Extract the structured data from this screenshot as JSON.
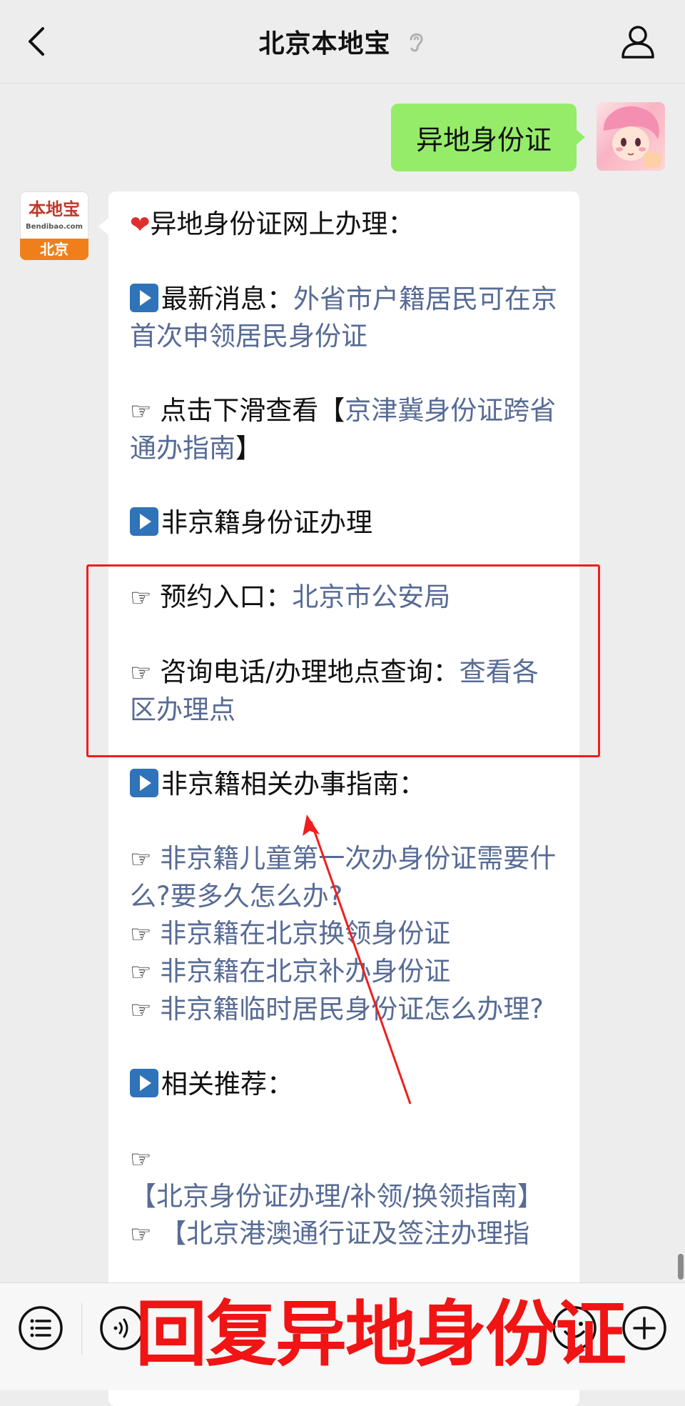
{
  "header": {
    "title": "北京本地宝"
  },
  "chat": {
    "outgoing_text": "异地身份证",
    "bot_avatar": {
      "logo_top": "本地宝",
      "logo_url": "Bendibao.com",
      "logo_bottom": "北京"
    },
    "message": {
      "heading": "异地身份证网上办理：",
      "news_label": "最新消息：",
      "news_link": "外省市户籍居民可在京首次申领居民身份证",
      "slide_prefix": "点击下滑查看【",
      "slide_link": "京津冀身份证跨省通办指南",
      "slide_suffix": "】",
      "section_nonlocal": "非京籍身份证办理",
      "appointment_label": "预约入口：",
      "appointment_link": "北京市公安局",
      "consult_label": "咨询电话/办理地点查询：",
      "consult_link": "查看各区办理点",
      "section_guide": "非京籍相关办事指南：",
      "guide_links": [
        "非京籍儿童第一次办身份证需要什么?要多久怎么办?",
        "非京籍在北京换领身份证",
        "非京籍在北京补办身份证",
        "非京籍临时居民身份证怎么办理?"
      ],
      "section_related": "相关推荐：",
      "related_link_1": "【北京身份证办理/补领/换领指南】",
      "related_link_2": "【北京港澳通行证及签注办理指"
    }
  },
  "overlay": {
    "caption": "回复异地身份证",
    "annotation_color": "#f01e1e"
  },
  "colors": {
    "background": "#ededed",
    "outgoing_bubble": "#95ec69",
    "incoming_bubble": "#ffffff",
    "link": "#576b95"
  },
  "icons": [
    "back-arrow-icon",
    "ear-icon",
    "user-icon",
    "heart-icon",
    "play-icon",
    "pointing-hand-icon",
    "menu-list-icon",
    "voice-icon",
    "emoji-icon",
    "plus-icon"
  ]
}
